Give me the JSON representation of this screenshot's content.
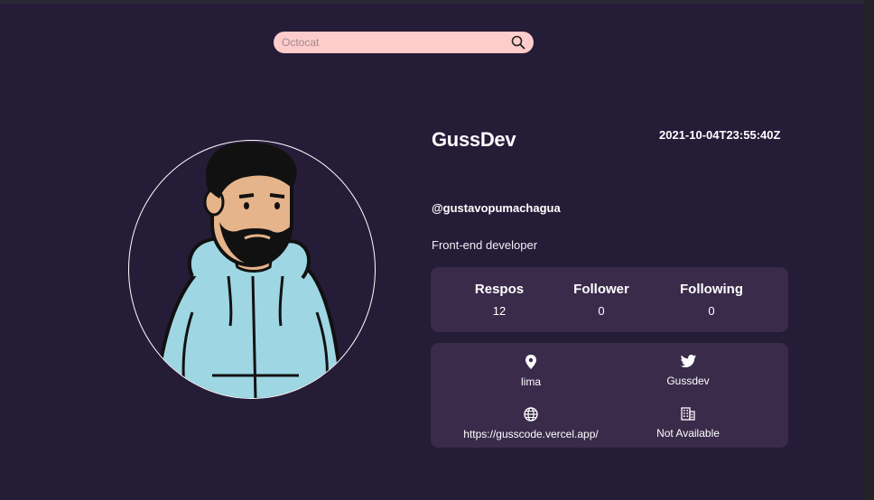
{
  "search": {
    "placeholder": "Octocat"
  },
  "profile": {
    "name": "GussDev",
    "joined": "2021-10-04T23:55:40Z",
    "login": "@gustavopumachagua",
    "bio": "Front-end developer"
  },
  "stats": [
    {
      "label": "Respos",
      "value": "12"
    },
    {
      "label": "Follower",
      "value": "0"
    },
    {
      "label": "Following",
      "value": "0"
    }
  ],
  "info": {
    "location": "lima",
    "twitter": "Gussdev",
    "website": "https://gusscode.vercel.app/",
    "company": "Not Available"
  },
  "icons": {
    "search": "search-icon",
    "location": "location-pin-icon",
    "twitter": "twitter-icon",
    "website": "globe-icon",
    "company": "building-icon"
  },
  "colors": {
    "background": "#251c38",
    "card": "#3a2b4b",
    "search_bg": "#ffcccc",
    "text": "#ffffff"
  }
}
